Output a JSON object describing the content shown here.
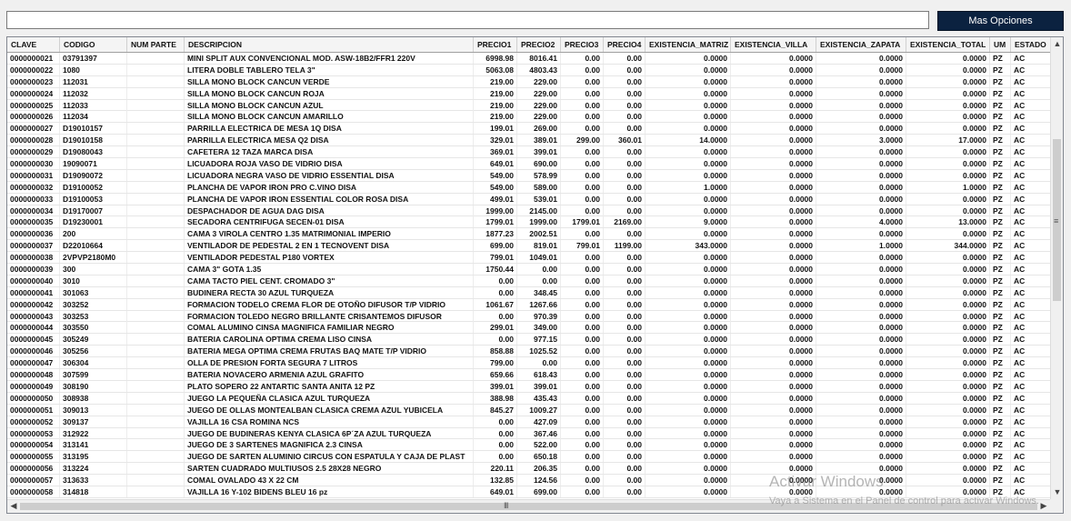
{
  "search": {
    "value": "",
    "placeholder": ""
  },
  "toolbar": {
    "more_options_label": "Mas Opciones"
  },
  "grid": {
    "columns": [
      "CLAVE",
      "CODIGO",
      "NUM PARTE",
      "DESCRIPCION",
      "PRECIO1",
      "PRECIO2",
      "PRECIO3",
      "PRECIO4",
      "EXISTENCIA_MATRIZ",
      "EXISTENCIA_VILLA",
      "EXISTENCIA_ZAPATA",
      "EXISTENCIA_TOTAL",
      "UM",
      "ESTADO"
    ],
    "rows": [
      [
        "0000000021",
        "03791397",
        "",
        "MINI SPLIT AUX CONVENCIONAL MOD. ASW-18B2/FFR1 220V",
        "6998.98",
        "8016.41",
        "0.00",
        "0.00",
        "0.0000",
        "0.0000",
        "0.0000",
        "0.0000",
        "PZ",
        "AC"
      ],
      [
        "0000000022",
        "1080",
        "",
        "LITERA DOBLE TABLERO TELA 3\"",
        "5063.08",
        "4803.43",
        "0.00",
        "0.00",
        "0.0000",
        "0.0000",
        "0.0000",
        "0.0000",
        "PZ",
        "AC"
      ],
      [
        "0000000023",
        "112031",
        "",
        "SILLA MONO BLOCK CANCUN VERDE",
        "219.00",
        "229.00",
        "0.00",
        "0.00",
        "0.0000",
        "0.0000",
        "0.0000",
        "0.0000",
        "PZ",
        "AC"
      ],
      [
        "0000000024",
        "112032",
        "",
        "SILLA MONO BLOCK CANCUN ROJA",
        "219.00",
        "229.00",
        "0.00",
        "0.00",
        "0.0000",
        "0.0000",
        "0.0000",
        "0.0000",
        "PZ",
        "AC"
      ],
      [
        "0000000025",
        "112033",
        "",
        "SILLA MONO BLOCK CANCUN AZUL",
        "219.00",
        "229.00",
        "0.00",
        "0.00",
        "0.0000",
        "0.0000",
        "0.0000",
        "0.0000",
        "PZ",
        "AC"
      ],
      [
        "0000000026",
        "112034",
        "",
        "SILLA MONO BLOCK CANCUN AMARILLO",
        "219.00",
        "229.00",
        "0.00",
        "0.00",
        "0.0000",
        "0.0000",
        "0.0000",
        "0.0000",
        "PZ",
        "AC"
      ],
      [
        "0000000027",
        "D19010157",
        "",
        "PARRILLA ELECTRICA DE MESA 1Q DISA",
        "199.01",
        "269.00",
        "0.00",
        "0.00",
        "0.0000",
        "0.0000",
        "0.0000",
        "0.0000",
        "PZ",
        "AC"
      ],
      [
        "0000000028",
        "D19010158",
        "",
        "PARRILLA ELECTRICA MESA Q2 DISA",
        "329.01",
        "389.01",
        "299.00",
        "360.01",
        "14.0000",
        "0.0000",
        "3.0000",
        "17.0000",
        "PZ",
        "AC"
      ],
      [
        "0000000029",
        "D19080043",
        "",
        "CAFETERA 12 TAZA MARCA DISA",
        "369.01",
        "399.01",
        "0.00",
        "0.00",
        "0.0000",
        "0.0000",
        "0.0000",
        "0.0000",
        "PZ",
        "AC"
      ],
      [
        "0000000030",
        "19090071",
        "",
        "LICUADORA ROJA VASO DE VIDRIO DISA",
        "649.01",
        "690.00",
        "0.00",
        "0.00",
        "0.0000",
        "0.0000",
        "0.0000",
        "0.0000",
        "PZ",
        "AC"
      ],
      [
        "0000000031",
        "D19090072",
        "",
        "LICUADORA NEGRA VASO DE VIDRIO ESSENTIAL DISA",
        "549.00",
        "578.99",
        "0.00",
        "0.00",
        "0.0000",
        "0.0000",
        "0.0000",
        "0.0000",
        "PZ",
        "AC"
      ],
      [
        "0000000032",
        "D19100052",
        "",
        "PLANCHA DE VAPOR IRON PRO C.VINO DISA",
        "549.00",
        "589.00",
        "0.00",
        "0.00",
        "1.0000",
        "0.0000",
        "0.0000",
        "1.0000",
        "PZ",
        "AC"
      ],
      [
        "0000000033",
        "D19100053",
        "",
        "PLANCHA DE VAPOR IRON ESSENTIAL COLOR ROSA DISA",
        "499.01",
        "539.01",
        "0.00",
        "0.00",
        "0.0000",
        "0.0000",
        "0.0000",
        "0.0000",
        "PZ",
        "AC"
      ],
      [
        "0000000034",
        "D19170007",
        "",
        "DESPACHADOR DE AGUA DAG DISA",
        "1999.00",
        "2145.00",
        "0.00",
        "0.00",
        "0.0000",
        "0.0000",
        "0.0000",
        "0.0000",
        "PZ",
        "AC"
      ],
      [
        "0000000035",
        "D19230001",
        "",
        "SECADORA CENTRIFUGA SECEN-01 DISA",
        "1799.01",
        "1999.00",
        "1799.01",
        "2169.00",
        "9.0000",
        "0.0000",
        "4.0000",
        "13.0000",
        "PZ",
        "AC"
      ],
      [
        "0000000036",
        "200",
        "",
        "CAMA 3 VIROLA CENTRO 1.35 MATRIMONIAL IMPERIO",
        "1877.23",
        "2002.51",
        "0.00",
        "0.00",
        "0.0000",
        "0.0000",
        "0.0000",
        "0.0000",
        "PZ",
        "AC"
      ],
      [
        "0000000037",
        "D22010664",
        "",
        "VENTILADOR DE PEDESTAL 2 EN 1 TECNOVENT DISA",
        "699.00",
        "819.01",
        "799.01",
        "1199.00",
        "343.0000",
        "0.0000",
        "1.0000",
        "344.0000",
        "PZ",
        "AC"
      ],
      [
        "0000000038",
        "2VPVP2180M0",
        "",
        "VENTILADOR PEDESTAL P180 VORTEX",
        "799.01",
        "1049.01",
        "0.00",
        "0.00",
        "0.0000",
        "0.0000",
        "0.0000",
        "0.0000",
        "PZ",
        "AC"
      ],
      [
        "0000000039",
        "300",
        "",
        "CAMA 3\" GOTA 1.35",
        "1750.44",
        "0.00",
        "0.00",
        "0.00",
        "0.0000",
        "0.0000",
        "0.0000",
        "0.0000",
        "PZ",
        "AC"
      ],
      [
        "0000000040",
        "3010",
        "",
        "CAMA TACTO PIEL CENT.  CROMADO 3\"",
        "0.00",
        "0.00",
        "0.00",
        "0.00",
        "0.0000",
        "0.0000",
        "0.0000",
        "0.0000",
        "PZ",
        "AC"
      ],
      [
        "0000000041",
        "301063",
        "",
        "BUDINERA RECTA 30 AZUL TURQUEZA",
        "0.00",
        "348.45",
        "0.00",
        "0.00",
        "0.0000",
        "0.0000",
        "0.0000",
        "0.0000",
        "PZ",
        "AC"
      ],
      [
        "0000000042",
        "303252",
        "",
        "FORMACION TODELO CREMA FLOR DE OTOÑO DIFUSOR T/P VIDRIO",
        "1061.67",
        "1267.66",
        "0.00",
        "0.00",
        "0.0000",
        "0.0000",
        "0.0000",
        "0.0000",
        "PZ",
        "AC"
      ],
      [
        "0000000043",
        "303253",
        "",
        "FORMACION TOLEDO NEGRO BRILLANTE CRISANTEMOS DIFUSOR",
        "0.00",
        "970.39",
        "0.00",
        "0.00",
        "0.0000",
        "0.0000",
        "0.0000",
        "0.0000",
        "PZ",
        "AC"
      ],
      [
        "0000000044",
        "303550",
        "",
        "COMAL ALUMINO CINSA MAGNIFICA FAMILIAR NEGRO",
        "299.01",
        "349.00",
        "0.00",
        "0.00",
        "0.0000",
        "0.0000",
        "0.0000",
        "0.0000",
        "PZ",
        "AC"
      ],
      [
        "0000000045",
        "305249",
        "",
        "BATERIA CAROLINA OPTIMA CREMA LISO CINSA",
        "0.00",
        "977.15",
        "0.00",
        "0.00",
        "0.0000",
        "0.0000",
        "0.0000",
        "0.0000",
        "PZ",
        "AC"
      ],
      [
        "0000000046",
        "305256",
        "",
        "BATERIA MEGA OPTIMA CREMA FRUTAS BAQ MATE T/P VIDRIO",
        "858.88",
        "1025.52",
        "0.00",
        "0.00",
        "0.0000",
        "0.0000",
        "0.0000",
        "0.0000",
        "PZ",
        "AC"
      ],
      [
        "0000000047",
        "306304",
        "",
        "OLLA DE PRESION FORTA SEGURA 7 LITROS",
        "799.00",
        "0.00",
        "0.00",
        "0.00",
        "0.0000",
        "0.0000",
        "0.0000",
        "0.0000",
        "PZ",
        "AC"
      ],
      [
        "0000000048",
        "307599",
        "",
        "BATERIA NOVACERO ARMENIA AZUL GRAFITO",
        "659.66",
        "618.43",
        "0.00",
        "0.00",
        "0.0000",
        "0.0000",
        "0.0000",
        "0.0000",
        "PZ",
        "AC"
      ],
      [
        "0000000049",
        "308190",
        "",
        "PLATO SOPERO 22 ANTARTIC SANTA ANITA 12 PZ",
        "399.01",
        "399.01",
        "0.00",
        "0.00",
        "0.0000",
        "0.0000",
        "0.0000",
        "0.0000",
        "PZ",
        "AC"
      ],
      [
        "0000000050",
        "308938",
        "",
        "JUEGO LA PEQUEÑA CLASICA AZUL TURQUEZA",
        "388.98",
        "435.43",
        "0.00",
        "0.00",
        "0.0000",
        "0.0000",
        "0.0000",
        "0.0000",
        "PZ",
        "AC"
      ],
      [
        "0000000051",
        "309013",
        "",
        "JUEGO DE OLLAS MONTEALBAN CLASICA CREMA AZUL YUBICELA",
        "845.27",
        "1009.27",
        "0.00",
        "0.00",
        "0.0000",
        "0.0000",
        "0.0000",
        "0.0000",
        "PZ",
        "AC"
      ],
      [
        "0000000052",
        "309137",
        "",
        "VAJILLA 16 CSA ROMINA NCS",
        "0.00",
        "427.09",
        "0.00",
        "0.00",
        "0.0000",
        "0.0000",
        "0.0000",
        "0.0000",
        "PZ",
        "AC"
      ],
      [
        "0000000053",
        "312922",
        "",
        "JUEGO DE BUDINERAS KENYA CLASICA 6P´ZA AZUL TURQUEZA",
        "0.00",
        "367.46",
        "0.00",
        "0.00",
        "0.0000",
        "0.0000",
        "0.0000",
        "0.0000",
        "PZ",
        "AC"
      ],
      [
        "0000000054",
        "313141",
        "",
        "JUEGO DE 3 SARTENES MAGNIFICA 2.3 CINSA",
        "0.00",
        "522.00",
        "0.00",
        "0.00",
        "0.0000",
        "0.0000",
        "0.0000",
        "0.0000",
        "PZ",
        "AC"
      ],
      [
        "0000000055",
        "313195",
        "",
        "JUEGO DE SARTEN ALUMINIO CIRCUS CON ESPATULA Y CAJA DE PLAST",
        "0.00",
        "650.18",
        "0.00",
        "0.00",
        "0.0000",
        "0.0000",
        "0.0000",
        "0.0000",
        "PZ",
        "AC"
      ],
      [
        "0000000056",
        "313224",
        "",
        "SARTEN CUADRADO MULTIUSOS 2.5 28X28 NEGRO",
        "220.11",
        "206.35",
        "0.00",
        "0.00",
        "0.0000",
        "0.0000",
        "0.0000",
        "0.0000",
        "PZ",
        "AC"
      ],
      [
        "0000000057",
        "313633",
        "",
        "COMAL OVALADO 43 X 22 CM",
        "132.85",
        "124.56",
        "0.00",
        "0.00",
        "0.0000",
        "0.0000",
        "0.0000",
        "0.0000",
        "PZ",
        "AC"
      ],
      [
        "0000000058",
        "314818",
        "",
        "VAJILLA 16 Y-102 BIDENS BLEU 16 pz",
        "649.01",
        "699.00",
        "0.00",
        "0.00",
        "0.0000",
        "0.0000",
        "0.0000",
        "0.0000",
        "PZ",
        "AC"
      ]
    ]
  },
  "scrollbar": {
    "up": "▲",
    "down": "▼",
    "left": "◀",
    "right": "▶",
    "grip_v": "≡",
    "grip_h": "III"
  },
  "watermark": {
    "title": "Activar Windows",
    "subtitle": "Vaya a Sistema en el Panel de control para activar Windows."
  }
}
